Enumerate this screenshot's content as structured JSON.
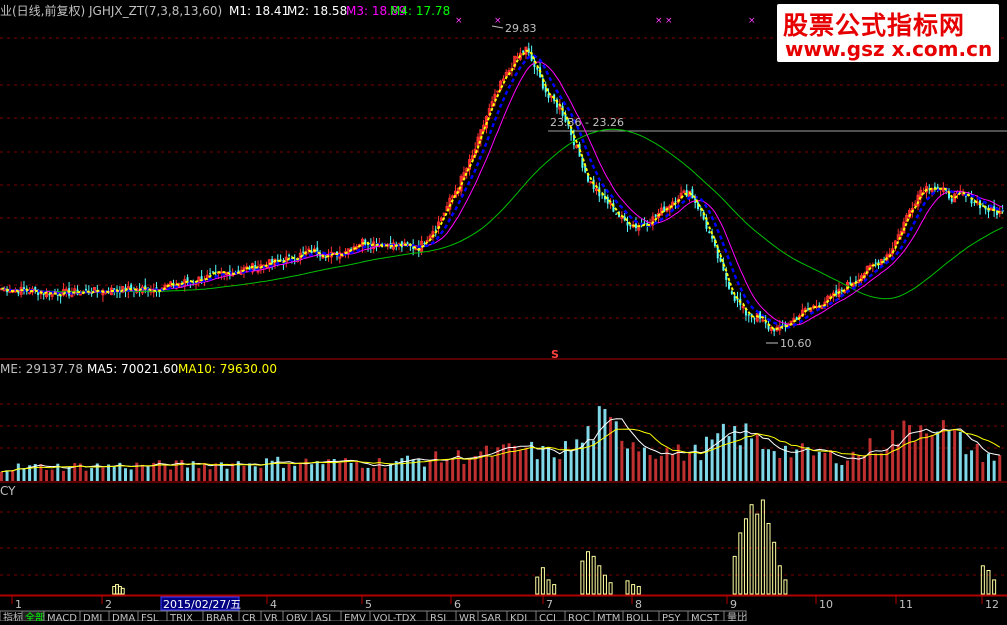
{
  "price_panel": {
    "header_title": "业(日线,前复权) JGHJX_ZT(7,3,8,13,60)",
    "m1": "M1: 18.41",
    "m2": "M2: 18.58",
    "m3": "M3: 18.89",
    "m4": "M4: 17.78",
    "annotation_high": "29.83",
    "annotation_mid": "23.36 - 23.26",
    "annotation_low": "10.60",
    "signal_mark": "S",
    "colors": {
      "m1": "#ffffff",
      "m2": "#ffffff",
      "m3": "#ff00ff",
      "m4": "#00ff00",
      "up": "#ff3232",
      "down": "#54fcfc",
      "yellow": "#ffff00",
      "blue": "#0000ff",
      "magenta": "#ff00ff",
      "green": "#00c000"
    }
  },
  "volume_panel": {
    "header": "ME: 29137.78",
    "ma5": "MA5: 70021.60",
    "ma10": "MA10: 79630.00"
  },
  "indicator_panel": {
    "label": "CY"
  },
  "axis": {
    "month_ticks": [
      "1",
      "2",
      "4",
      "5",
      "6",
      "7",
      "8",
      "9",
      "10",
      "11",
      "12"
    ],
    "cursor_date": "2015/02/27/五"
  },
  "tabs": [
    "指标",
    "全部",
    "MACD",
    "DMI",
    "DMA",
    "FSL",
    "TRIX",
    "BRAR",
    "CR",
    "VR",
    "OBV",
    "ASI",
    "EMV",
    "VOL-TDX",
    "RSI",
    "WR",
    "SAR",
    "KDJ",
    "CCI",
    "ROC",
    "MTM",
    "BOLL",
    "PSY",
    "MCST",
    "量比"
  ],
  "watermark": {
    "line1": "股票公式指标网",
    "line2": "www.gsz x.com.cn"
  },
  "chart_data": {
    "type": "candlestick",
    "title": "JGHJX_ZT(7,3,8,13,60)",
    "ylim": [
      10.0,
      30.5
    ],
    "xlabels": [
      "1",
      "2",
      "4",
      "5",
      "6",
      "7",
      "8",
      "9",
      "10",
      "11",
      "12"
    ],
    "close_anchors": [
      [
        0,
        13.6
      ],
      [
        20,
        13.3
      ],
      [
        40,
        13.5
      ],
      [
        55,
        13.6
      ],
      [
        70,
        14.2
      ],
      [
        85,
        14.8
      ],
      [
        100,
        15.4
      ],
      [
        110,
        16.0
      ],
      [
        118,
        15.7
      ],
      [
        128,
        16.6
      ],
      [
        138,
        16.4
      ],
      [
        148,
        16.2
      ],
      [
        155,
        17.8
      ],
      [
        162,
        20.2
      ],
      [
        167,
        22.0
      ],
      [
        172,
        24.6
      ],
      [
        177,
        26.6
      ],
      [
        182,
        28.2
      ],
      [
        186,
        28.9
      ],
      [
        190,
        27.4
      ],
      [
        194,
        25.8
      ],
      [
        198,
        25.2
      ],
      [
        201,
        24.0
      ],
      [
        204,
        22.5
      ],
      [
        208,
        20.6
      ],
      [
        212,
        19.6
      ],
      [
        216,
        18.9
      ],
      [
        220,
        18.0
      ],
      [
        225,
        17.6
      ],
      [
        230,
        17.9
      ],
      [
        235,
        18.7
      ],
      [
        240,
        19.5
      ],
      [
        244,
        19.8
      ],
      [
        248,
        18.5
      ],
      [
        252,
        16.6
      ],
      [
        256,
        14.6
      ],
      [
        260,
        13.0
      ],
      [
        264,
        12.0
      ],
      [
        268,
        11.8
      ],
      [
        272,
        11.1
      ],
      [
        276,
        11.0
      ],
      [
        280,
        11.5
      ],
      [
        285,
        12.2
      ],
      [
        290,
        12.6
      ],
      [
        295,
        13.1
      ],
      [
        300,
        13.8
      ],
      [
        305,
        14.5
      ],
      [
        310,
        15.2
      ],
      [
        315,
        15.9
      ],
      [
        318,
        17.0
      ],
      [
        322,
        18.6
      ],
      [
        326,
        19.9
      ],
      [
        330,
        20.2
      ],
      [
        334,
        19.8
      ],
      [
        337,
        19.4
      ],
      [
        340,
        19.6
      ],
      [
        345,
        19.2
      ],
      [
        350,
        18.6
      ],
      [
        355,
        18.4
      ]
    ],
    "volume_anchors": [
      [
        0,
        0.13
      ],
      [
        60,
        0.15
      ],
      [
        100,
        0.18
      ],
      [
        130,
        0.17
      ],
      [
        150,
        0.2
      ],
      [
        170,
        0.25
      ],
      [
        185,
        0.3
      ],
      [
        195,
        0.25
      ],
      [
        205,
        0.35
      ],
      [
        212,
        0.55
      ],
      [
        220,
        0.45
      ],
      [
        230,
        0.3
      ],
      [
        245,
        0.25
      ],
      [
        255,
        0.4
      ],
      [
        262,
        0.45
      ],
      [
        270,
        0.35
      ],
      [
        280,
        0.28
      ],
      [
        300,
        0.22
      ],
      [
        320,
        0.45
      ],
      [
        330,
        0.6
      ],
      [
        335,
        0.45
      ],
      [
        345,
        0.28
      ],
      [
        355,
        0.2
      ]
    ],
    "osc_spikes": [
      [
        40,
        8
      ],
      [
        41,
        10
      ],
      [
        42,
        8
      ],
      [
        43,
        6
      ],
      [
        190,
        18
      ],
      [
        192,
        28
      ],
      [
        194,
        15
      ],
      [
        196,
        10
      ],
      [
        206,
        35
      ],
      [
        208,
        45
      ],
      [
        210,
        40
      ],
      [
        212,
        30
      ],
      [
        214,
        20
      ],
      [
        216,
        12
      ],
      [
        222,
        14
      ],
      [
        224,
        10
      ],
      [
        226,
        8
      ],
      [
        260,
        40
      ],
      [
        262,
        65
      ],
      [
        264,
        80
      ],
      [
        266,
        95
      ],
      [
        268,
        85
      ],
      [
        270,
        100
      ],
      [
        272,
        75
      ],
      [
        274,
        55
      ],
      [
        276,
        30
      ],
      [
        278,
        15
      ],
      [
        348,
        30
      ],
      [
        350,
        25
      ],
      [
        352,
        15
      ]
    ]
  }
}
